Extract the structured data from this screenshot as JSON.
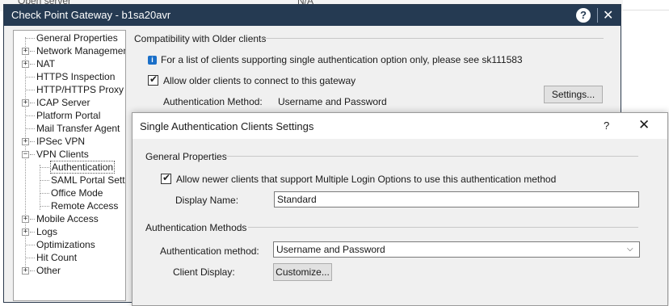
{
  "background": {
    "text_left": "Open server",
    "text_mid": "N/A"
  },
  "window": {
    "title": "Check Point Gateway - b1sa20avr",
    "help_icon": "question-icon",
    "close_icon": "close-icon"
  },
  "tree": {
    "items": [
      {
        "label": "General Properties"
      },
      {
        "label": "Network Management"
      },
      {
        "label": "NAT"
      },
      {
        "label": "HTTPS Inspection"
      },
      {
        "label": "HTTP/HTTPS Proxy"
      },
      {
        "label": "ICAP Server"
      },
      {
        "label": "Platform Portal"
      },
      {
        "label": "Mail Transfer Agent"
      },
      {
        "label": "IPSec VPN"
      },
      {
        "label": "VPN Clients"
      },
      {
        "label": "Authentication"
      },
      {
        "label": "SAML Portal Settin"
      },
      {
        "label": "Office Mode"
      },
      {
        "label": "Remote Access"
      },
      {
        "label": "Mobile Access"
      },
      {
        "label": "Logs"
      },
      {
        "label": "Optimizations"
      },
      {
        "label": "Hit Count"
      },
      {
        "label": "Other"
      }
    ]
  },
  "compat": {
    "section_title": "Compatibility with Older clients",
    "info_text": "For a list of clients supporting single authentication option only, please see sk111583",
    "allow_older_label": "Allow older clients to connect to this gateway",
    "allow_older_checked": true,
    "settings_button": "Settings...",
    "auth_method_label": "Authentication Method:",
    "auth_method_value": "Username and Password"
  },
  "child_dialog": {
    "title": "Single Authentication Clients Settings",
    "help": "?",
    "close": "✕",
    "general_section": "General Properties",
    "allow_newer_label": "Allow newer clients that support Multiple Login Options to use this authentication method",
    "allow_newer_checked": true,
    "display_name_label": "Display Name:",
    "display_name_value": "Standard",
    "auth_methods_section": "Authentication Methods",
    "auth_method_label": "Authentication method:",
    "auth_method_value": "Username and Password",
    "client_display_label": "Client Display:",
    "customize_button": "Customize..."
  }
}
